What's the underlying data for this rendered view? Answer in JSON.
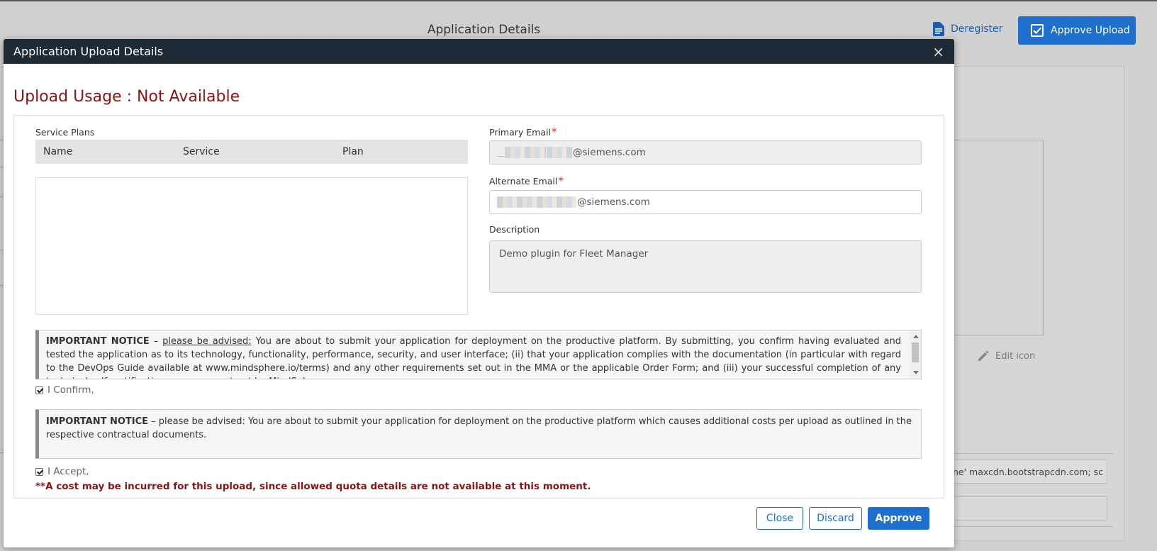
{
  "background": {
    "page_title": "Application Details",
    "deregister_label": "Deregister",
    "approve_upload_label": "Approve Upload",
    "edit_icon_label": "Edit icon",
    "csp_field_value": "ne' maxcdn.bootstrapcdn.com; sc"
  },
  "modal": {
    "title": "Application Upload Details",
    "close_glyph": "×",
    "usage_heading": "Upload Usage : Not Available",
    "service_plans": {
      "label": "Service Plans",
      "columns": [
        "Name",
        "Service",
        "Plan"
      ],
      "rows": []
    },
    "primary_email": {
      "label": "Primary Email",
      "required_mark": "*",
      "value_suffix": "@siemens.com"
    },
    "alternate_email": {
      "label": "Alternate Email",
      "required_mark": "*",
      "value_suffix": "@siemens.com"
    },
    "description": {
      "label": "Description",
      "value": "Demo plugin for Fleet Manager"
    },
    "notice1": {
      "lead": "IMPORTANT NOTICE",
      "dash": " – ",
      "advised": "please be advised:",
      "body": " You are about to submit your application for deployment on the productive platform. By submitting, you confirm having evaluated and tested the application as to its technology, functionality, performance, security, and user interface; (ii) that your application complies with the documentation (in particular with regard to the DevOps Guide available at www.mindsphere.io/terms) and any other requirements set out in the MMA or the applicable Order Form; and (iii) your successful completion of any technical self-certification process as set out by MindSphere."
    },
    "confirm_label": "I Confirm,",
    "notice2": {
      "lead": "IMPORTANT NOTICE",
      "body": " – please be advised: You are about to submit your application for deployment on the productive platform which causes additional costs per upload as outlined in the respective contractual documents."
    },
    "accept_label": "I Accept,",
    "cost_warning": "**A cost may be incurred for this upload, since allowed quota details are not available at this moment.",
    "buttons": {
      "close": "Close",
      "discard": "Discard",
      "approve": "Approve"
    }
  },
  "colors": {
    "header_bg": "#1c2b35",
    "heading_red": "#8b1414",
    "primary_blue": "#1f6fce",
    "required_red": "#d32f2f"
  }
}
